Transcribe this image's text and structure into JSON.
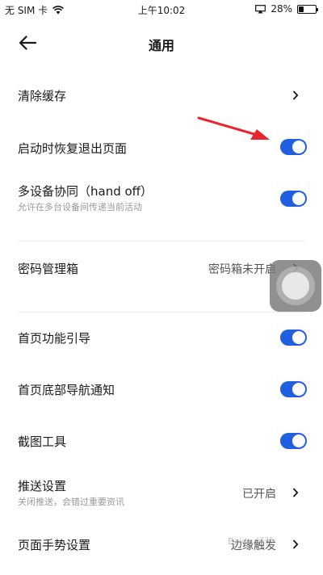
{
  "status_bar": {
    "carrier": "无 SIM 卡",
    "time": "上午10:02",
    "battery": "28%",
    "battery_fraction": 0.28,
    "icons": [
      "wifi-icon",
      "airplay-icon",
      "battery-icon"
    ]
  },
  "nav": {
    "title": "通用",
    "back_icon": "arrow-left-icon"
  },
  "settings": {
    "clear_cache": {
      "title": "清除缓存"
    },
    "restore_pages": {
      "title": "启动时恢复退出页面",
      "enabled": true
    },
    "handoff": {
      "title": "多设备协同（hand off）",
      "subtitle": "允许在多台设备间传递当前活动",
      "enabled": true
    },
    "password_box": {
      "title": "密码管理箱",
      "value": "密码箱未开启"
    },
    "home_guide": {
      "title": "首页功能引导",
      "enabled": true
    },
    "bottom_nav_notice": {
      "title": "首页底部导航通知",
      "enabled": true
    },
    "screenshot_tool": {
      "title": "截图工具",
      "enabled": true
    },
    "push": {
      "title": "推送设置",
      "subtitle": "关闭推送，会错过重要资讯",
      "value": "已开启"
    },
    "gesture": {
      "title": "页面手势设置",
      "value": "边缘触发"
    }
  },
  "colors": {
    "toggle_on": "#1f5fe0",
    "annotation_arrow": "#e8262b"
  },
  "watermark": "Baidu 经验"
}
